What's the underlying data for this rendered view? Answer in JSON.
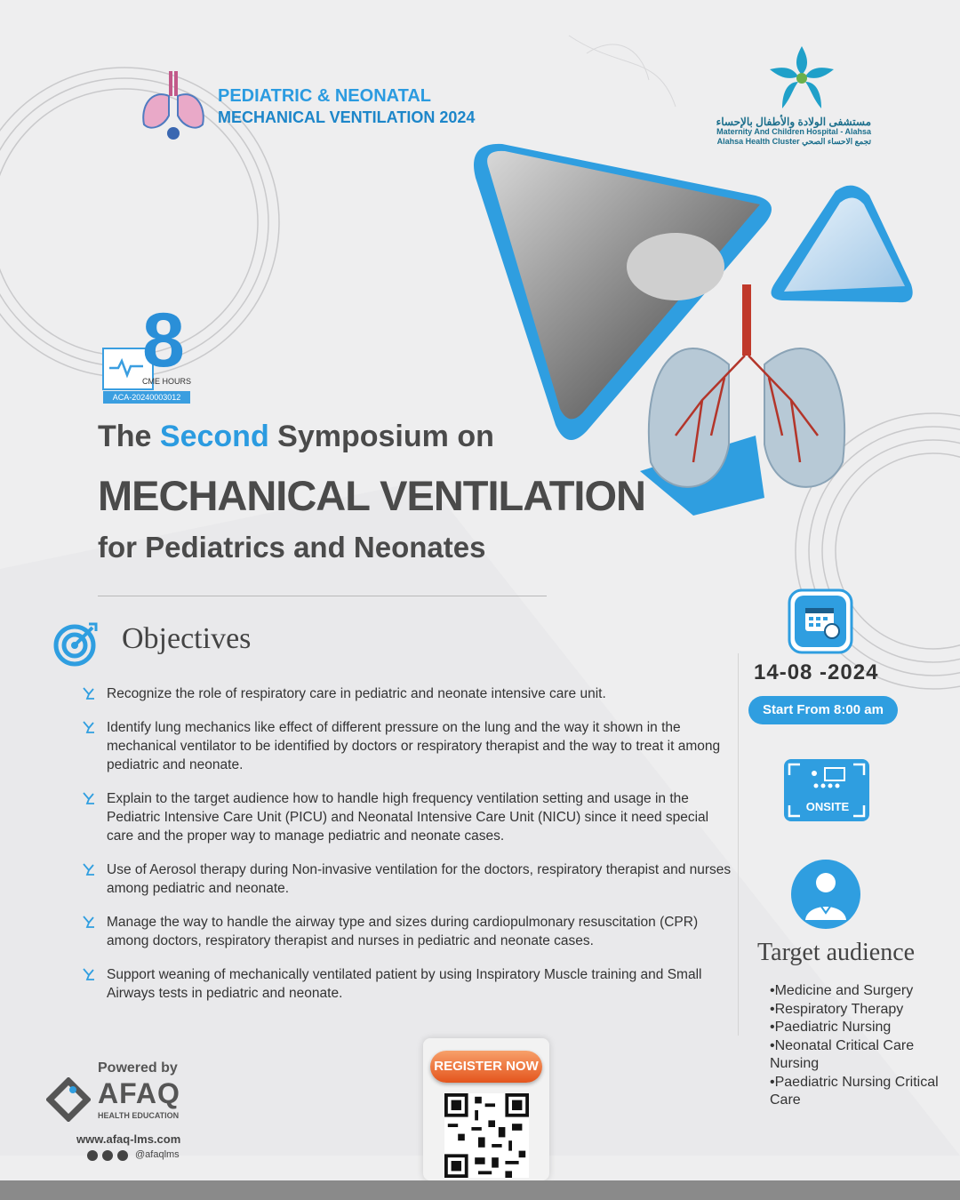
{
  "header": {
    "event_line1": "PEDIATRIC & NEONATAL",
    "event_line2": "MECHANICAL VENTILATION 2024",
    "hospital_arabic": "مستشفى الولادة والأطفال بالإحساء",
    "hospital_english": "Maternity And Children Hospital - Alahsa",
    "cluster": "Alahsa Health Cluster   تجمع الاحساء الصحي"
  },
  "cme": {
    "hours": "8",
    "label": "CME HOURS",
    "code": "ACA-20240003012"
  },
  "title": {
    "word_the": "The",
    "word_second": "Second",
    "rest_line1": "Symposium on",
    "line2": "MECHANICAL VENTILATION",
    "line3": "for Pediatrics and Neonates"
  },
  "objectives": {
    "heading": "Objectives",
    "items": [
      "Recognize the role of respiratory care in pediatric and neonate intensive care unit.",
      "Identify lung mechanics like effect of different pressure on the lung and the way it shown in the mechanical ventilator to be identified by doctors or respiratory therapist and the way to treat it among pediatric and neonate.",
      "Explain to the target audience how to handle high frequency ventilation setting and usage in the Pediatric Intensive Care Unit (PICU) and Neonatal Intensive Care Unit (NICU) since it need special care and the proper way to manage pediatric and neonate cases.",
      "Use of Aerosol therapy during Non-invasive ventilation for the doctors, respiratory therapist and nurses among pediatric and neonate.",
      "Manage the way to handle the airway type and sizes during cardiopulmonary resuscitation (CPR) among doctors, respiratory therapist and nurses in pediatric and neonate cases.",
      "Support weaning of mechanically ventilated patient by using Inspiratory Muscle training and Small Airways tests in pediatric and neonate."
    ]
  },
  "schedule": {
    "date": "14-08 -2024",
    "time": "Start From 8:00 am",
    "mode": "ONSITE"
  },
  "audience": {
    "heading": "Target audience",
    "items": [
      "•Medicine and Surgery",
      "•Respiratory Therapy",
      "•Paediatric Nursing",
      "•Neonatal Critical Care Nursing",
      "•Paediatric Nursing Critical Care"
    ]
  },
  "footer": {
    "powered_by": "Powered by",
    "brand": "AFAQ",
    "brand_sub": "HEALTH EDUCATION",
    "website": "www.afaq-lms.com",
    "social_handle": "@afaqlms",
    "register_label": "REGISTER NOW"
  },
  "colors": {
    "accent_blue": "#2b9be0",
    "text_dark": "#4a4a4a",
    "register_orange": "#e4551d",
    "background": "#eeeeef"
  },
  "icons": [
    "lungs-logo-icon",
    "star-hospital-logo-icon",
    "target-icon",
    "calendar-icon",
    "onsite-audience-icon",
    "doctor-icon",
    "qr-code",
    "afaq-logo-icon",
    "instagram-icon",
    "facebook-icon",
    "twitter-icon"
  ]
}
